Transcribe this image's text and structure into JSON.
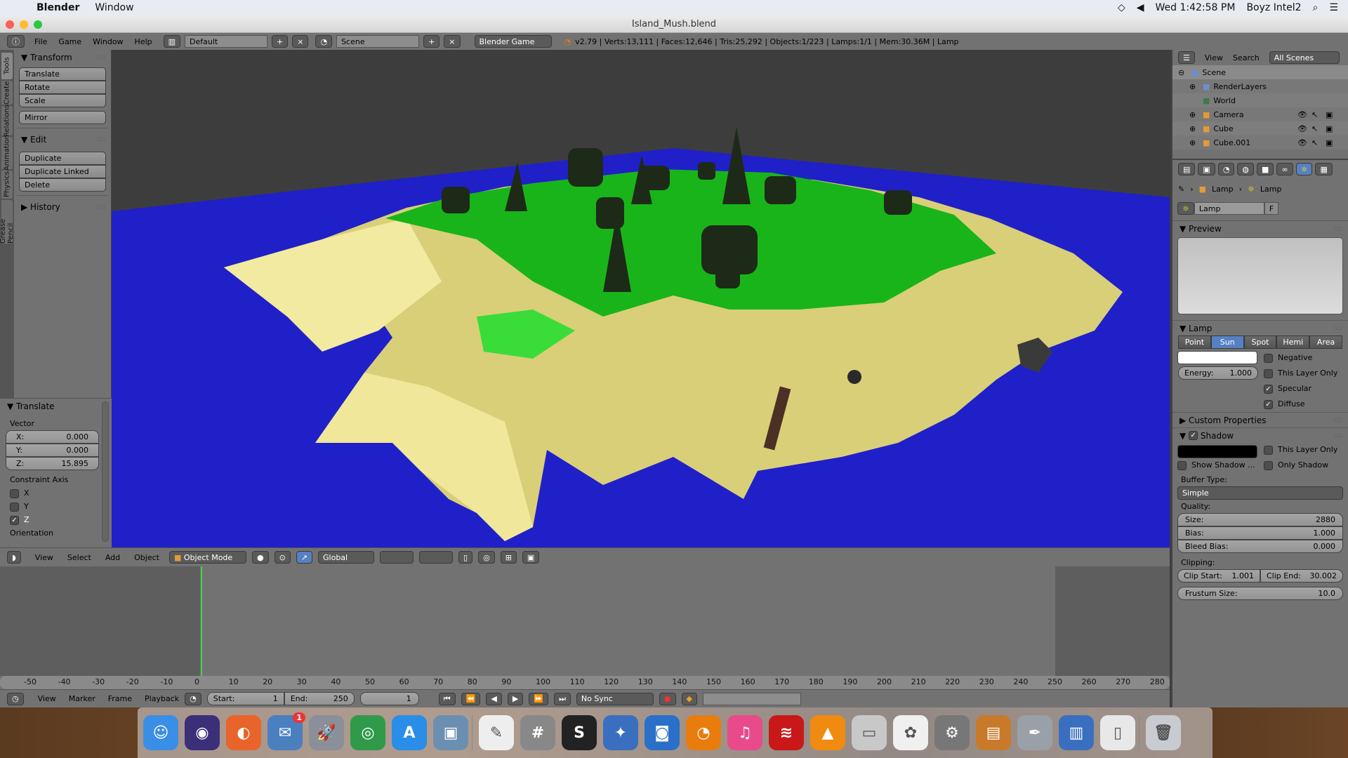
{
  "mac_menubar": {
    "app": "Blender",
    "menus": [
      "Window"
    ],
    "clock": "Wed 1:42:58 PM",
    "user": "Boyz Intel2"
  },
  "window": {
    "title": "Island_Mush.blend"
  },
  "header": {
    "menus": [
      "File",
      "Game",
      "Window",
      "Help"
    ],
    "layout": "Default",
    "scene": "Scene",
    "engine": "Blender Game",
    "stats": "v2.79 | Verts:13,111 | Faces:12,646 | Tris:25,292 | Objects:1/223 | Lamps:1/1 | Mem:30.36M | Lamp"
  },
  "tool_tabs": [
    "Tools",
    "Create",
    "Relations",
    "Animation",
    "Physics",
    "Grease Pencil"
  ],
  "tools": {
    "transform": {
      "title": "Transform",
      "buttons": [
        "Translate",
        "Rotate",
        "Scale"
      ],
      "mirror": "Mirror"
    },
    "edit": {
      "title": "Edit",
      "buttons": [
        "Duplicate",
        "Duplicate Linked",
        "Delete"
      ]
    },
    "history": {
      "title": "History"
    }
  },
  "operator": {
    "title": "Translate",
    "vector_label": "Vector",
    "x": {
      "label": "X:",
      "value": "0.000"
    },
    "y": {
      "label": "Y:",
      "value": "0.000"
    },
    "z": {
      "label": "Z:",
      "value": "15.895"
    },
    "constraint_label": "Constraint Axis",
    "axes": [
      {
        "label": "X",
        "checked": false
      },
      {
        "label": "Y",
        "checked": false
      },
      {
        "label": "Z",
        "checked": true
      }
    ],
    "orientation_label": "Orientation"
  },
  "viewport_header": {
    "menus": [
      "View",
      "Select",
      "Add",
      "Object"
    ],
    "mode": "Object Mode",
    "orientation": "Global"
  },
  "timeline": {
    "ruler": [
      "-50",
      "-40",
      "-30",
      "-20",
      "-10",
      "0",
      "10",
      "20",
      "30",
      "40",
      "50",
      "60",
      "70",
      "80",
      "90",
      "100",
      "110",
      "120",
      "130",
      "140",
      "150",
      "160",
      "170",
      "180",
      "190",
      "200",
      "210",
      "220",
      "230",
      "240",
      "250",
      "260",
      "270",
      "280"
    ],
    "menus": [
      "View",
      "Marker",
      "Frame",
      "Playback"
    ],
    "start_label": "Start:",
    "start": "1",
    "end_label": "End:",
    "end": "250",
    "current": "1",
    "sync": "No Sync"
  },
  "outliner": {
    "menus": [
      "View",
      "Search"
    ],
    "filter": "All Scenes",
    "items": [
      {
        "name": "Scene",
        "icon": "scene-icon",
        "color": "#6b8fd0"
      },
      {
        "name": "RenderLayers",
        "icon": "render-layers-icon",
        "color": "#6b8fd0"
      },
      {
        "name": "World",
        "icon": "world-icon",
        "color": "#3d7a4a"
      },
      {
        "name": "Camera",
        "icon": "camera-icon",
        "color": "#e39a3a"
      },
      {
        "name": "Cube",
        "icon": "mesh-icon",
        "color": "#e39a3a"
      },
      {
        "name": "Cube.001",
        "icon": "mesh-icon",
        "color": "#e39a3a"
      }
    ]
  },
  "properties": {
    "breadcrumb": [
      "Lamp",
      "Lamp"
    ],
    "datablock": "Lamp",
    "fake_user": "F",
    "preview_title": "Preview",
    "lamp_title": "Lamp",
    "lamp_types": [
      "Point",
      "Sun",
      "Spot",
      "Hemi",
      "Area"
    ],
    "lamp_active": "Sun",
    "lamp_color": "#ffffff",
    "energy_label": "Energy:",
    "energy": "1.000",
    "lamp_checks": [
      {
        "label": "Negative",
        "checked": false
      },
      {
        "label": "This Layer Only",
        "checked": false
      },
      {
        "label": "Specular",
        "checked": true
      },
      {
        "label": "Diffuse",
        "checked": true
      }
    ],
    "custom_props": "Custom Properties",
    "shadow_title": "Shadow",
    "shadow_color": "#000000",
    "shadow_checks": [
      {
        "label": "This Layer Only",
        "checked": false
      },
      {
        "label": "Show Shadow ...",
        "checked": false
      },
      {
        "label": "Only Shadow",
        "checked": false
      }
    ],
    "buffer_label": "Buffer Type:",
    "buffer": "Simple",
    "quality_label": "Quality:",
    "size_label": "Size:",
    "size": "2880",
    "bias_label": "Bias:",
    "bias": "1.000",
    "bleed_label": "Bleed Bias:",
    "bleed": "0.000",
    "clipping_label": "Clipping:",
    "clip_start_label": "Clip Start:",
    "clip_start": "1.001",
    "clip_end_label": "Clip End:",
    "clip_end": "30.002",
    "frustum_label": "Frustum Size:",
    "frustum": "10.0"
  },
  "dock": [
    {
      "name": "Finder",
      "color": "#3a8ee6",
      "glyph": "☺"
    },
    {
      "name": "Siri",
      "color": "#3b2f7a",
      "glyph": "◉"
    },
    {
      "name": "Firefox",
      "color": "#e8642a",
      "glyph": "◐"
    },
    {
      "name": "Thunderbird",
      "color": "#4a7fc0",
      "glyph": "✉",
      "badge": "1"
    },
    {
      "name": "Launchpad",
      "color": "#8a8f99",
      "glyph": "🚀"
    },
    {
      "name": "Chrome",
      "color": "#2f9a4a",
      "glyph": "◎"
    },
    {
      "name": "App Store",
      "color": "#2a8de8",
      "glyph": "A"
    },
    {
      "name": "Preview",
      "color": "#6b8fb0",
      "glyph": "▣"
    },
    {
      "name": "TextEdit",
      "color": "#eeeeee",
      "glyph": "✎"
    },
    {
      "name": "Calculator",
      "color": "#888888",
      "glyph": "#"
    },
    {
      "name": "Scrivener",
      "color": "#222222",
      "glyph": "S"
    },
    {
      "name": "Pixelmator",
      "color": "#3a6fc0",
      "glyph": "✦"
    },
    {
      "name": "Image Capture",
      "color": "#2a70c8",
      "glyph": "◙"
    },
    {
      "name": "Blender",
      "color": "#e87d0d",
      "glyph": "◔"
    },
    {
      "name": "iTunes",
      "color": "#e84a8a",
      "glyph": "♫"
    },
    {
      "name": "Spotify",
      "color": "#c81818",
      "glyph": "≋"
    },
    {
      "name": "VLC",
      "color": "#f08a10",
      "glyph": "▲"
    },
    {
      "name": "Disk",
      "color": "#c8c8c8",
      "glyph": "▭"
    },
    {
      "name": "Photos",
      "color": "#f0f0f0",
      "glyph": "✿"
    },
    {
      "name": "System Preferences",
      "color": "#777777",
      "glyph": "⚙"
    },
    {
      "name": "Keynote",
      "color": "#c87a2a",
      "glyph": "▤"
    },
    {
      "name": "Script Editor",
      "color": "#9aa0a8",
      "glyph": "✒"
    },
    {
      "name": "Grapher",
      "color": "#3a6fc0",
      "glyph": "▥"
    },
    {
      "name": "Archive",
      "color": "#e8e8e8",
      "glyph": "▯"
    },
    {
      "name": "Trash",
      "color": "#c8ccd0",
      "glyph": "🗑"
    }
  ],
  "colors": {
    "ocean": "#2020c8",
    "sand": "#e8df8a",
    "grass": "#1bb81b",
    "accent": "#5680c2",
    "frame_line": "#3fd43f"
  }
}
